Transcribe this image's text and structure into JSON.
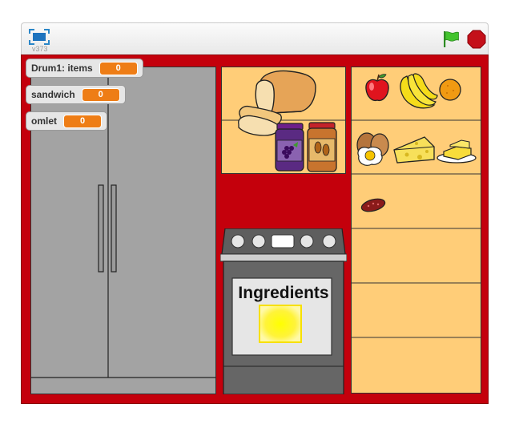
{
  "player": {
    "version": "v373",
    "icons": {
      "fullscreen": "fullscreen-icon",
      "green_flag": "green-flag-icon",
      "stop": "stop-sign-icon"
    }
  },
  "watchers": [
    {
      "label": "Drum1: items",
      "value": "0"
    },
    {
      "label": "sandwich",
      "value": "0"
    },
    {
      "label": "omlet",
      "value": "0"
    }
  ],
  "stove": {
    "display_text": "Ingredients"
  },
  "colors": {
    "stage_background": "#c4000c",
    "watcher_value": "#ee7d16",
    "shelf": "#ffcd78",
    "fridge": "#a0a0a0",
    "oven": "#666666"
  },
  "sprites": {
    "pantry": [
      "bread-loaf",
      "bread-slices",
      "grape-jelly-jar",
      "peanut-butter-jar"
    ],
    "shelf": [
      "apple",
      "bananas",
      "orange",
      "eggs",
      "cheese",
      "butter",
      "sausage-slice"
    ]
  }
}
